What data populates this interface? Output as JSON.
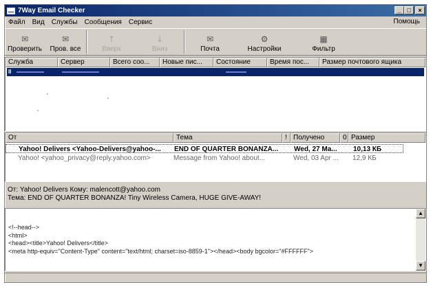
{
  "window": {
    "title": "7Way Email Checker"
  },
  "menu": {
    "items": [
      "Файл",
      "Вид",
      "Службы",
      "Сообщения",
      "Сервис"
    ],
    "help": "Помощь"
  },
  "toolbar": {
    "buttons": [
      {
        "label": "Проверить",
        "icon": "check-mail-icon",
        "enabled": true
      },
      {
        "label": "Пров. все",
        "icon": "check-all-icon",
        "enabled": true
      },
      {
        "label": "Вверх",
        "icon": "arrow-up-icon",
        "enabled": false
      },
      {
        "label": "Вниз",
        "icon": "arrow-down-icon",
        "enabled": false
      },
      {
        "label": "Почта",
        "icon": "mail-icon",
        "enabled": true
      },
      {
        "label": "Настройки",
        "icon": "settings-icon",
        "enabled": true
      },
      {
        "label": "Фильтр",
        "icon": "filter-icon",
        "enabled": true
      }
    ]
  },
  "accounts": {
    "columns": [
      "Служба",
      "Сервер",
      "Всего соо...",
      "Новые пис...",
      "Состояние",
      "Время пос...",
      "Размер почтового ящика"
    ],
    "selected_row": {
      "marker": "II"
    }
  },
  "messages": {
    "columns": [
      "От",
      "Тема",
      "!",
      "Получено",
      "0",
      "Размер"
    ],
    "rows": [
      {
        "from": "Yahoo! Delivers <Yahoo-Delivers@yahoo-...",
        "subject": "END OF QUARTER BONANZA...",
        "received": "Wed, 27 Ma...",
        "size": "10,13 КБ",
        "unread": true
      },
      {
        "from": "Yahoo! <yahoo_privacy@reply.yahoo.com>",
        "subject": "Message from Yahoo! about...",
        "received": "Wed, 03 Apr ...",
        "size": "12,9 КБ",
        "unread": false
      }
    ]
  },
  "preview": {
    "from_line": "От: Yahoo! Delivers Кому: malencott@yahoo.com",
    "subject_line": "Тема: END OF QUARTER BONANZA! Tiny Wireless Camera, HUGE GIVE-AWAY!",
    "body": [
      "<!--head-->",
      "<html>",
      "<head><title>Yahoo! Delivers</title>",
      "<meta http-equiv=\"Content-Type\" content=\"text/html; charset=iso-8859-1\"></head><body bgcolor=\"#FFFFFF\">"
    ]
  },
  "colors": {
    "title_bar": "#0a246a",
    "selection": "#0a246a",
    "face": "#d4d0c8"
  }
}
